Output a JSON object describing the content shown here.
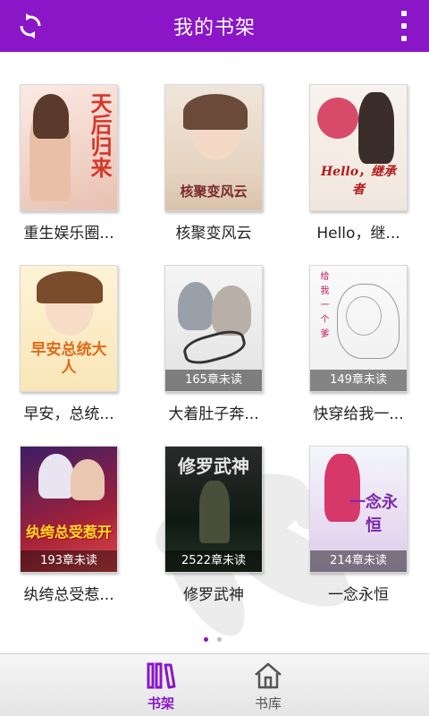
{
  "header": {
    "title": "我的书架"
  },
  "books": [
    {
      "title": "重生娱乐圈...",
      "cover_text": "天后归来",
      "unread": ""
    },
    {
      "title": "核聚变风云",
      "cover_text": "核聚变风云",
      "unread": ""
    },
    {
      "title": "Hello，继...",
      "cover_text": "Hello，继承者",
      "unread": ""
    },
    {
      "title": "早安，总统...",
      "cover_text": "早安总统大人",
      "unread": ""
    },
    {
      "title": "大着肚子奔...",
      "cover_text": "",
      "unread": "165章未读"
    },
    {
      "title": "快穿给我一...",
      "cover_text": "给我一个爹",
      "unread": "149章未读"
    },
    {
      "title": "纨绔总受惹...",
      "cover_text": "纨绔总受惹开",
      "unread": "193章未读"
    },
    {
      "title": "修罗武神",
      "cover_text": "修罗武神",
      "unread": "2522章未读"
    },
    {
      "title": "一念永恒",
      "cover_text": "一念永恒",
      "unread": "214章未读"
    }
  ],
  "pager": {
    "pages": 2,
    "current": 1
  },
  "tabs": [
    {
      "label": "书架",
      "icon": "bookshelf-icon",
      "active": true
    },
    {
      "label": "书库",
      "icon": "home-icon",
      "active": false
    }
  ],
  "colors": {
    "accent": "#8a16c8"
  }
}
